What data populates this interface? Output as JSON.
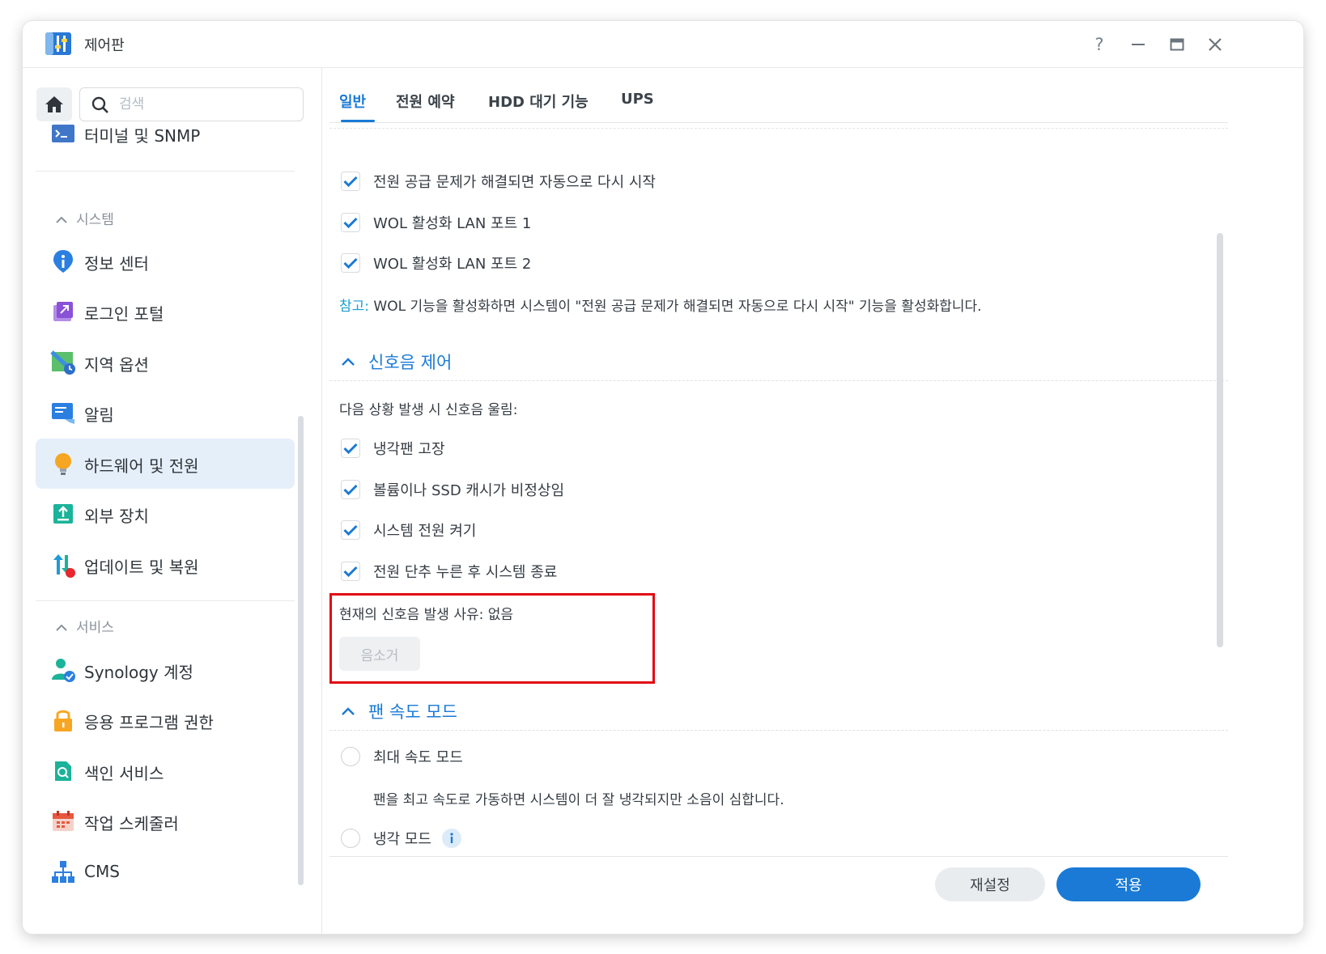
{
  "window": {
    "title": "제어판"
  },
  "sidebar": {
    "search_placeholder": "검색",
    "partial_item": "터미널 및 SNMP",
    "system_section": "시스템",
    "system_items": [
      {
        "label": "정보 센터",
        "icon": "info-icon"
      },
      {
        "label": "로그인 포털",
        "icon": "login-portal-icon"
      },
      {
        "label": "지역 옵션",
        "icon": "regional-options-icon"
      },
      {
        "label": "알림",
        "icon": "notification-icon"
      },
      {
        "label": "하드웨어 및 전원",
        "icon": "hardware-power-icon",
        "active": true
      },
      {
        "label": "외부 장치",
        "icon": "external-device-icon"
      },
      {
        "label": "업데이트 및 복원",
        "icon": "update-restore-icon"
      }
    ],
    "services_section": "서비스",
    "service_items": [
      {
        "label": "Synology 계정",
        "icon": "synology-account-icon"
      },
      {
        "label": "응용 프로그램 권한",
        "icon": "app-privileges-icon"
      },
      {
        "label": "색인 서비스",
        "icon": "indexing-service-icon"
      },
      {
        "label": "작업 스케줄러",
        "icon": "task-scheduler-icon"
      },
      {
        "label": "CMS",
        "icon": "cms-icon"
      }
    ]
  },
  "tabs": [
    "일반",
    "전원 예약",
    "HDD 대기 기능",
    "UPS"
  ],
  "general": {
    "auto_restart": "전원 공급 문제가 해결되면 자동으로 다시 시작",
    "wol1": "WOL 활성화 LAN 포트 1",
    "wol2": "WOL 활성화 LAN 포트 2",
    "note_key": "참고:",
    "note_text": " WOL 기능을 활성화하면 시스템이 \"전원 공급 문제가 해결되면 자동으로 다시 시작\" 기능을 활성화합니다."
  },
  "beep": {
    "title": "신호음 제어",
    "intro": "다음 상황 발생 시 신호음 울림:",
    "options": [
      "냉각팬 고장",
      "볼륨이나 SSD 캐시가 비정상임",
      "시스템 전원 켜기",
      "전원 단추 누른 후 시스템 종료"
    ],
    "current_reason": "현재의 신호음 발생 사유: 없음",
    "silence_button": "음소거"
  },
  "fan": {
    "title": "팬 속도 모드",
    "full_speed": "최대 속도 모드",
    "full_speed_desc": "팬을 최고 속도로 가동하면 시스템이 더 잘 냉각되지만 소음이 심합니다.",
    "cool_mode": "냉각 모드"
  },
  "footer": {
    "reset": "재설정",
    "apply": "적용"
  },
  "colors": {
    "accent": "#1a7ad6",
    "highlight_border": "#e20b14",
    "note_key": "#1a9fcf"
  }
}
